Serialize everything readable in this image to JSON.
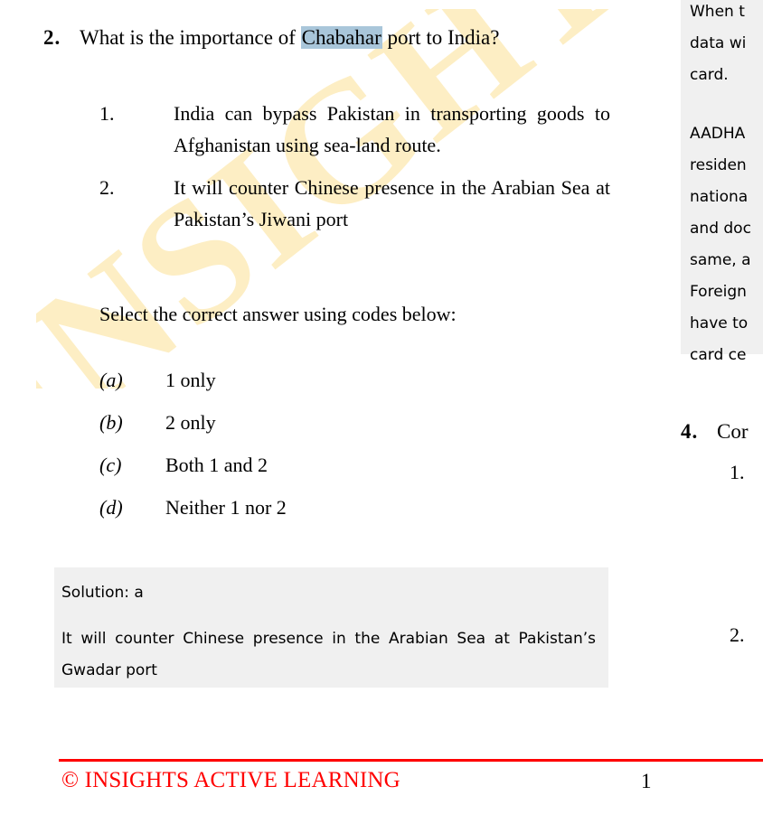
{
  "watermark": {
    "text": "INSIGHTS",
    "color": "#fdeec4"
  },
  "question": {
    "number": "2.",
    "text_before_highlight": "What is the importance of ",
    "highlight_term": "Chabahar",
    "highlight_color": "#a9c6da",
    "text_after_highlight": " port to India?",
    "statements": [
      {
        "number": "1.",
        "text": "India can bypass Pakistan in transporting goods to Afghanistan using sea-land route."
      },
      {
        "number": "2.",
        "text": "It will counter Chinese presence in the Arabian Sea at Pakistan’s Jiwani port"
      }
    ],
    "select_instruction": "Select the correct answer using codes below:",
    "options": [
      {
        "key": "(a)",
        "label": "1 only"
      },
      {
        "key": "(b)",
        "label": "2 only"
      },
      {
        "key": "(c)",
        "label": "Both 1 and 2"
      },
      {
        "key": "(d)",
        "label": "Neither 1 nor 2"
      }
    ]
  },
  "solution": {
    "heading": "Solution: a",
    "body": "It will counter Chinese presence in the Arabian Sea at Pakistan’s Gwadar port",
    "background_color": "#f0f0f0"
  },
  "right_column": {
    "clipped_box": {
      "line1": "When t",
      "line2": "data wi",
      "line3": "card.",
      "line4": "AADHA",
      "line5": "residen",
      "line6": "nationa",
      "line7": "and doc",
      "line8": "same, a",
      "line9": "Foreign",
      "line10": "have to",
      "line11": "card ce"
    },
    "question": {
      "number": "4.",
      "text": "Cor"
    },
    "sub_items": [
      {
        "number": "1."
      },
      {
        "number": "2."
      }
    ]
  },
  "footer": {
    "brand": "© INSIGHTS ACTIVE LEARNING",
    "page_number": "1",
    "rule_color": "#ff0000",
    "brand_color": "#ff0000"
  }
}
